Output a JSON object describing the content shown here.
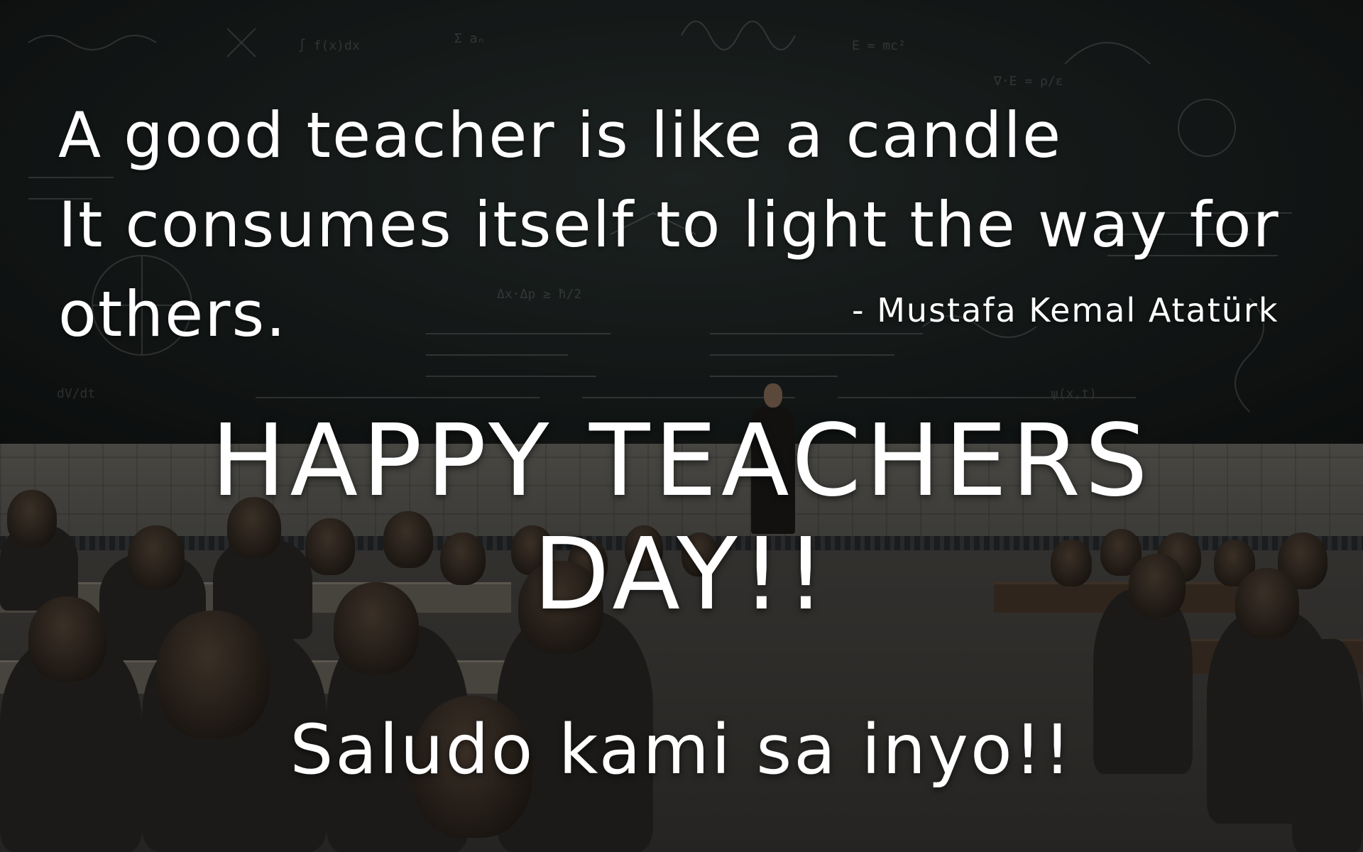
{
  "quote": {
    "lines": [
      "A good teacher is like a candle",
      "It consumes itself to light the way for",
      "others."
    ],
    "author": "- Mustafa Kemal Atatürk"
  },
  "headline": {
    "line1": "HAPPY TEACHERS",
    "line2": "DAY!!"
  },
  "subline": "Saludo kami sa inyo!!",
  "colors": {
    "text": "#ffffff",
    "chalkboard": "#1d2322"
  }
}
